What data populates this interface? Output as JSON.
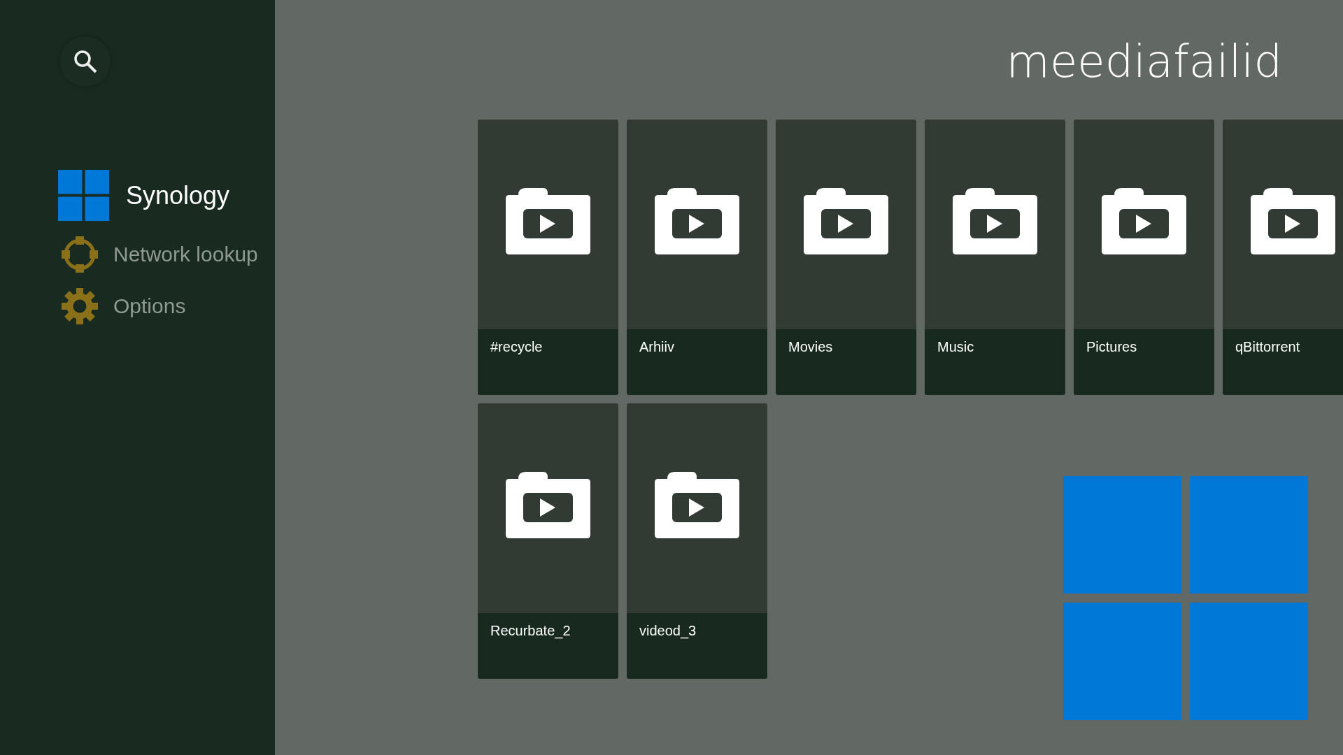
{
  "sidebar": {
    "header": "Synology",
    "items": [
      {
        "kind": "network",
        "label": "Network lookup"
      },
      {
        "kind": "options",
        "label": "Options"
      }
    ]
  },
  "title": "meediafailid",
  "folders": [
    {
      "name": "#recycle"
    },
    {
      "name": "Arhiiv"
    },
    {
      "name": "Movies"
    },
    {
      "name": "Music"
    },
    {
      "name": "Pictures"
    },
    {
      "name": "qBittorrent"
    },
    {
      "name": "Recurbate_2"
    },
    {
      "name": "videod_3"
    }
  ]
}
